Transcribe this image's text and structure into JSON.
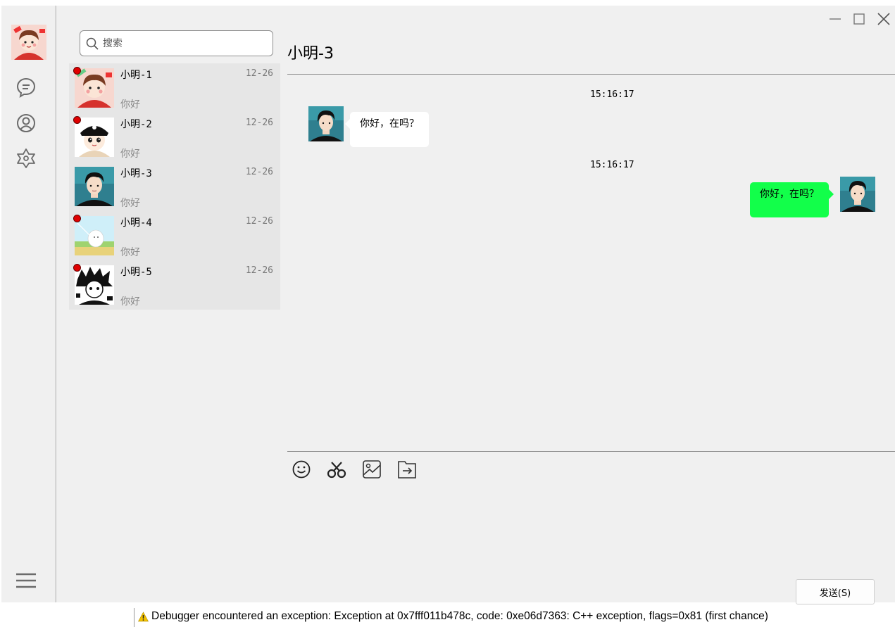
{
  "window": {
    "controls": [
      "minimize-icon",
      "maximize-icon",
      "close-icon"
    ]
  },
  "nav": {
    "icons": [
      "chat-bubble-icon",
      "contacts-icon",
      "discover-icon",
      "menu-icon"
    ]
  },
  "search": {
    "placeholder": "搜索",
    "value": ""
  },
  "sessions": [
    {
      "name": "小明-1",
      "date": "12-26",
      "preview": "你好",
      "unread": true
    },
    {
      "name": "小明-2",
      "date": "12-26",
      "preview": "你好",
      "unread": true
    },
    {
      "name": "小明-3",
      "date": "12-26",
      "preview": "你好",
      "unread": false
    },
    {
      "name": "小明-4",
      "date": "12-26",
      "preview": "你好",
      "unread": true
    },
    {
      "name": "小明-5",
      "date": "12-26",
      "preview": "你好",
      "unread": true
    }
  ],
  "chat": {
    "title": "小明-3",
    "messages": [
      {
        "time": "15:16:17",
        "text": "你好，在吗？",
        "side": "left"
      },
      {
        "time": "15:16:17",
        "text": "你好，在吗？",
        "side": "right"
      }
    ],
    "toolbar": [
      "emoji-icon",
      "scissors-icon",
      "image-icon",
      "file-send-icon"
    ],
    "send_label": "发送(S)"
  },
  "colors": {
    "bubble_self": "#12ff4a",
    "bubble_other": "#ffffff",
    "unread_dot": "#e00000",
    "panel_bg": "#f0f0f0"
  },
  "debugger": {
    "message": "Debugger encountered an exception: Exception at 0x7fff011b478c, code: 0xe06d7363: C++ exception, flags=0x81 (first chance)"
  }
}
